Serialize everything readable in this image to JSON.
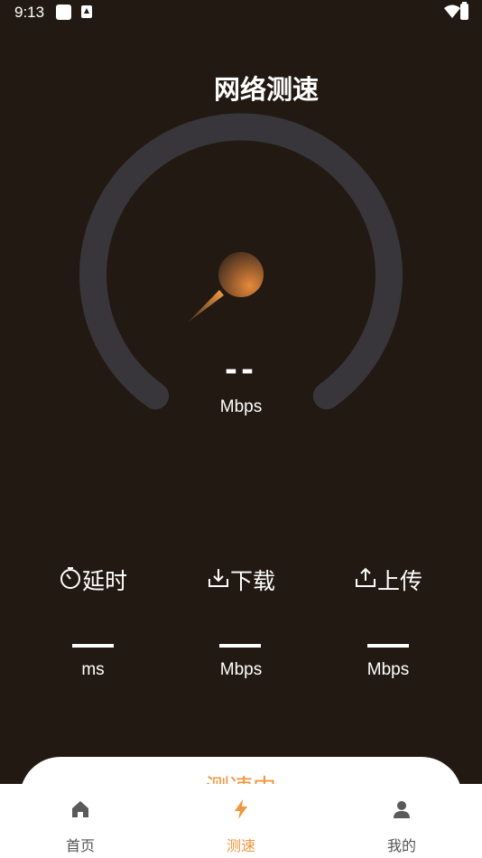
{
  "status_bar": {
    "time": "9:13"
  },
  "header": {
    "title": "网络测速"
  },
  "gauge": {
    "value": "--",
    "unit": "Mbps"
  },
  "metrics": [
    {
      "icon": "timer-icon",
      "label": "延时",
      "unit": "ms"
    },
    {
      "icon": "download-icon",
      "label": "下载",
      "unit": "Mbps"
    },
    {
      "icon": "upload-icon",
      "label": "上传",
      "unit": "Mbps"
    }
  ],
  "action_button": {
    "label": "测速中"
  },
  "bottom_nav": {
    "items": [
      {
        "label": "首页",
        "icon": "home-icon",
        "active": false
      },
      {
        "label": "测速",
        "icon": "lightning-icon",
        "active": true
      },
      {
        "label": "我的",
        "icon": "user-icon",
        "active": false
      }
    ]
  },
  "colors": {
    "background": "#221a12",
    "accent": "#f0963f",
    "track": "#38363a"
  }
}
